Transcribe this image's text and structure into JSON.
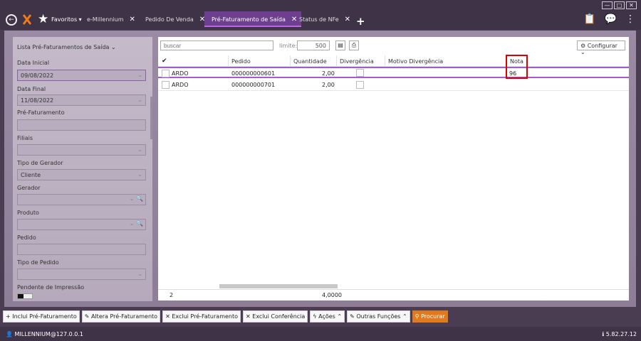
{
  "window": {
    "controls": [
      "—",
      "□",
      "✕"
    ]
  },
  "header": {
    "favorites_label": "Favoritos",
    "tabs": [
      {
        "label": "e-Millennium",
        "active": false
      },
      {
        "label": "Pedido De Venda",
        "active": false
      },
      {
        "label": "Pré-Faturamento de Saída",
        "active": true
      },
      {
        "label": "Status de NFe",
        "active": false
      }
    ]
  },
  "filters": {
    "title": "Lista Pré-Faturamentos de Saída",
    "data_inicial_label": "Data Inicial",
    "data_inicial_value": "09/08/2022",
    "data_final_label": "Data Final",
    "data_final_value": "11/08/2022",
    "pre_faturamento_label": "Pré-Faturamento",
    "filiais_label": "Filiais",
    "tipo_gerador_label": "Tipo de Gerador",
    "tipo_gerador_value": "Cliente",
    "gerador_label": "Gerador",
    "produto_label": "Produto",
    "pedido_label": "Pedido",
    "tipo_pedido_label": "Tipo de Pedido",
    "pendente_label": "Pendente de Impressão"
  },
  "grid": {
    "search_placeholder": "buscar",
    "limite_label": "limite:",
    "limite_value": "500",
    "config_label": "Configurar",
    "columns": [
      "Pedido",
      "Quantidade",
      "Divergência",
      "Motivo Divergência",
      "Nota"
    ],
    "rows": [
      {
        "name": "ARDO",
        "pedido": "000000000601",
        "quantidade": "2,00",
        "motivo": "",
        "nota": "96"
      },
      {
        "name": "ARDO",
        "pedido": "000000000701",
        "quantidade": "2,00",
        "motivo": "",
        "nota": ""
      }
    ],
    "footer_count": "2",
    "footer_total": "4,0000"
  },
  "actions": [
    "Inclui Pré-Faturamento",
    "Altera Pré-Faturamento",
    "Exclui Pré-Faturamento",
    "Exclui Conferência",
    "Ações",
    "Outras Funções",
    "Procurar"
  ],
  "status": {
    "user": "MILLENNIUM@127.0.0.1",
    "version": "5.82.27.12"
  },
  "colors": {
    "accent": "#a45ad6",
    "primary_button": "#e07a1f",
    "highlight_box": "#e00000"
  }
}
